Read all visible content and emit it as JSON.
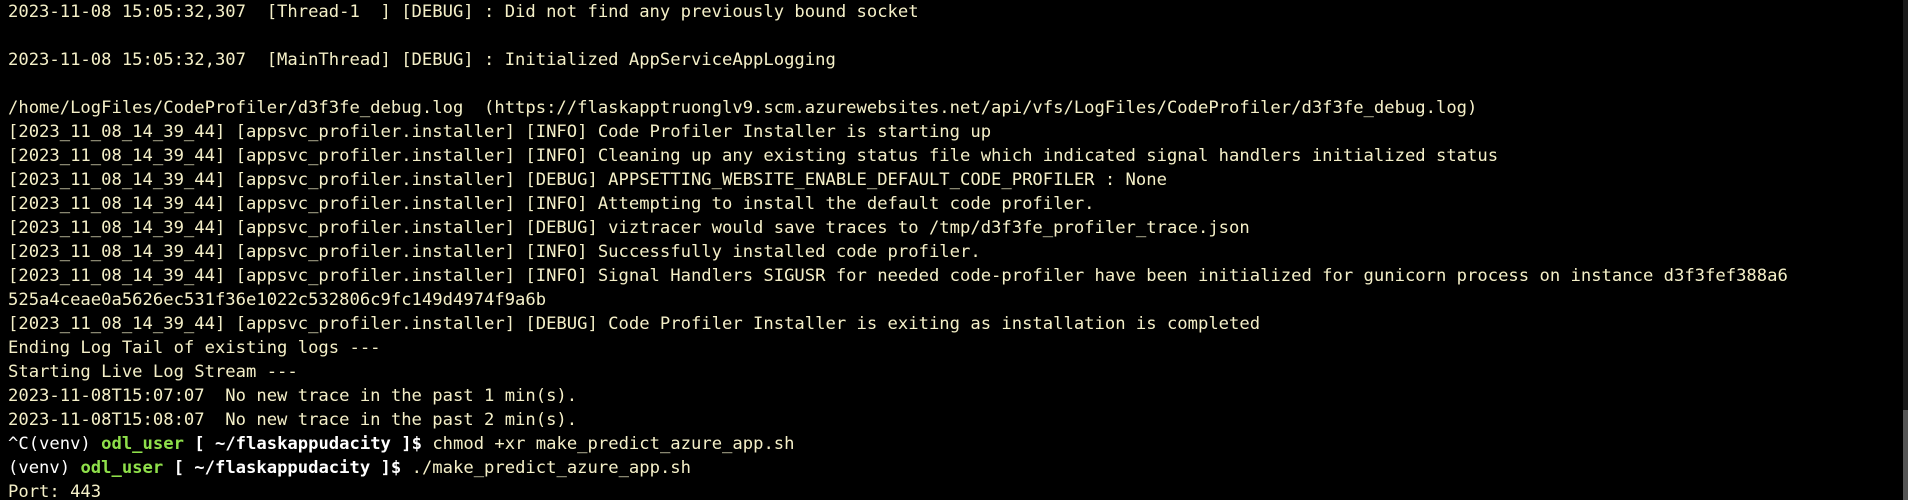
{
  "lines": [
    "2023-11-08 15:05:32,307  [Thread-1  ] [DEBUG] : Did not find any previously bound socket",
    "",
    "2023-11-08 15:05:32,307  [MainThread] [DEBUG] : Initialized AppServiceAppLogging",
    "",
    "/home/LogFiles/CodeProfiler/d3f3fe_debug.log  (https://flaskapptruonglv9.scm.azurewebsites.net/api/vfs/LogFiles/CodeProfiler/d3f3fe_debug.log)",
    "[2023_11_08_14_39_44] [appsvc_profiler.installer] [INFO] Code Profiler Installer is starting up",
    "[2023_11_08_14_39_44] [appsvc_profiler.installer] [INFO] Cleaning up any existing status file which indicated signal handlers initialized status",
    "[2023_11_08_14_39_44] [appsvc_profiler.installer] [DEBUG] APPSETTING_WEBSITE_ENABLE_DEFAULT_CODE_PROFILER : None",
    "[2023_11_08_14_39_44] [appsvc_profiler.installer] [INFO] Attempting to install the default code profiler.",
    "[2023_11_08_14_39_44] [appsvc_profiler.installer] [DEBUG] viztracer would save traces to /tmp/d3f3fe_profiler_trace.json",
    "[2023_11_08_14_39_44] [appsvc_profiler.installer] [INFO] Successfully installed code profiler.",
    "[2023_11_08_14_39_44] [appsvc_profiler.installer] [INFO] Signal Handlers SIGUSR for needed code-profiler have been initialized for gunicorn process on instance d3f3fef388a6",
    "525a4ceae0a5626ec531f36e1022c532806c9fc149d4974f9a6b",
    "[2023_11_08_14_39_44] [appsvc_profiler.installer] [DEBUG] Code Profiler Installer is exiting as installation is completed",
    "Ending Log Tail of existing logs ---",
    "Starting Live Log Stream ---",
    "2023-11-08T15:07:07  No new trace in the past 1 min(s).",
    "2023-11-08T15:08:07  No new trace in the past 2 min(s)."
  ],
  "prompt1": {
    "prefix": "^C(venv) ",
    "user": "odl_user",
    "open": " [ ",
    "path": "~/flaskappudacity",
    "close": " ]$ ",
    "command": "chmod +xr make_predict_azure_app.sh"
  },
  "prompt2": {
    "prefix": "(venv) ",
    "user": "odl_user",
    "open": " [ ",
    "path": "~/flaskappudacity",
    "close": " ]$ ",
    "command": "./make_predict_azure_app.sh"
  },
  "last_line": "Port: 443",
  "colors": {
    "background": "#000000",
    "text": "#f5f0c8",
    "user": "#8fe04a",
    "path": "#ffffff"
  }
}
